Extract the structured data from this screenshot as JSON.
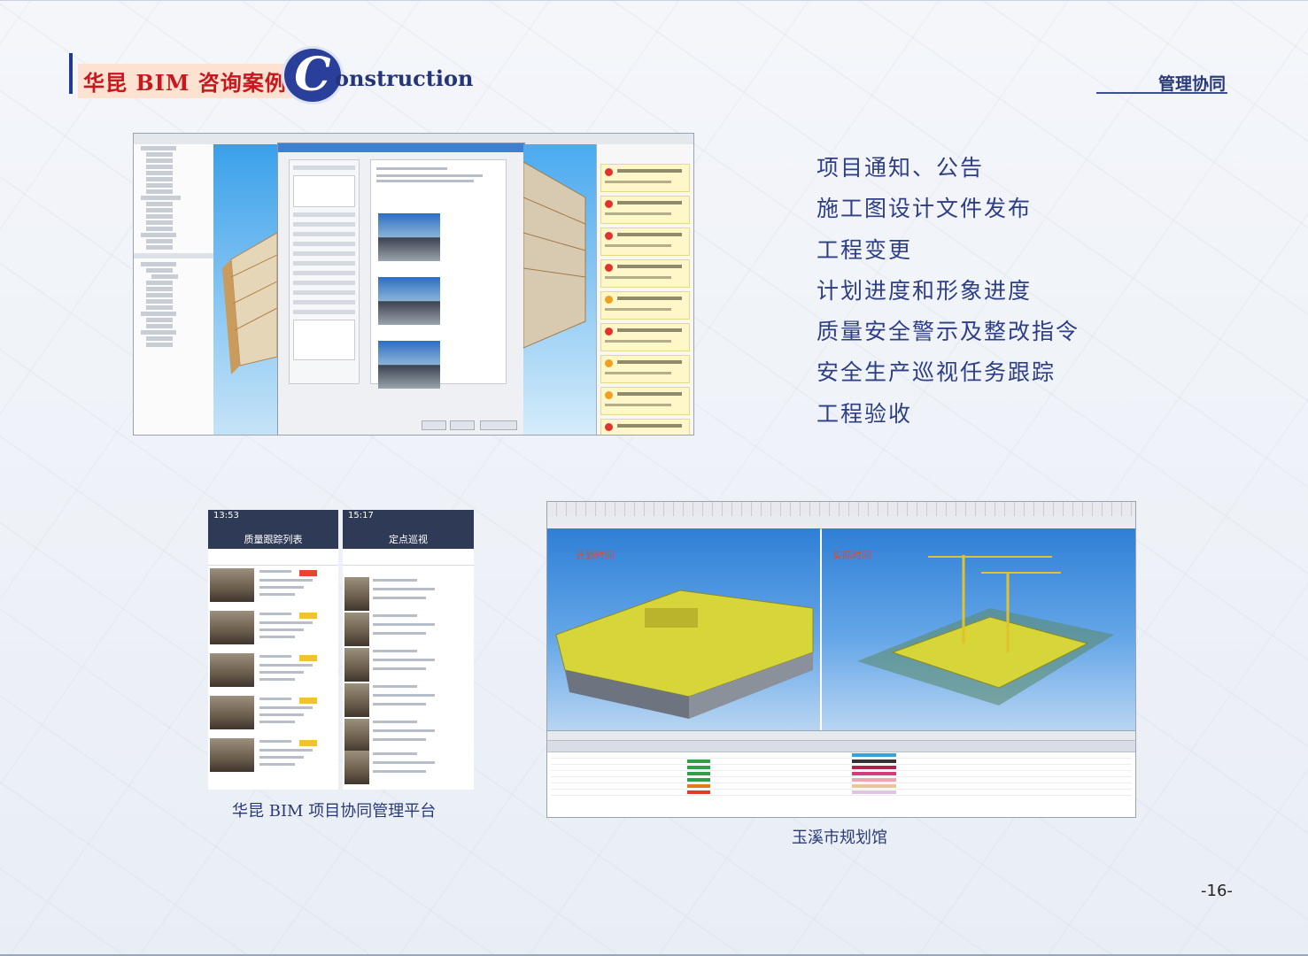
{
  "header": {
    "brand_text": "华昆 BIM 咨询案例",
    "brand_logo_letter": "C",
    "brand_word": "onstruction",
    "section_title": "管理协同"
  },
  "features": [
    "项目通知、公告",
    "施工图设计文件发布",
    "工程变更",
    "计划进度和形象进度",
    "质量安全警示及整改指令",
    "安全生产巡视任务跟踪",
    "工程验收"
  ],
  "phone_left": {
    "time": "13:53",
    "title": "质量跟踪列表"
  },
  "phone_right": {
    "time": "15:17",
    "title": "定点巡视"
  },
  "planning_view": {
    "left_label": "计划时间",
    "right_label": "实际时间"
  },
  "captions": {
    "platform": "华昆 BIM 项目协同管理平台",
    "planning_hall": "玉溪市规划馆"
  },
  "page_number": "-16-"
}
